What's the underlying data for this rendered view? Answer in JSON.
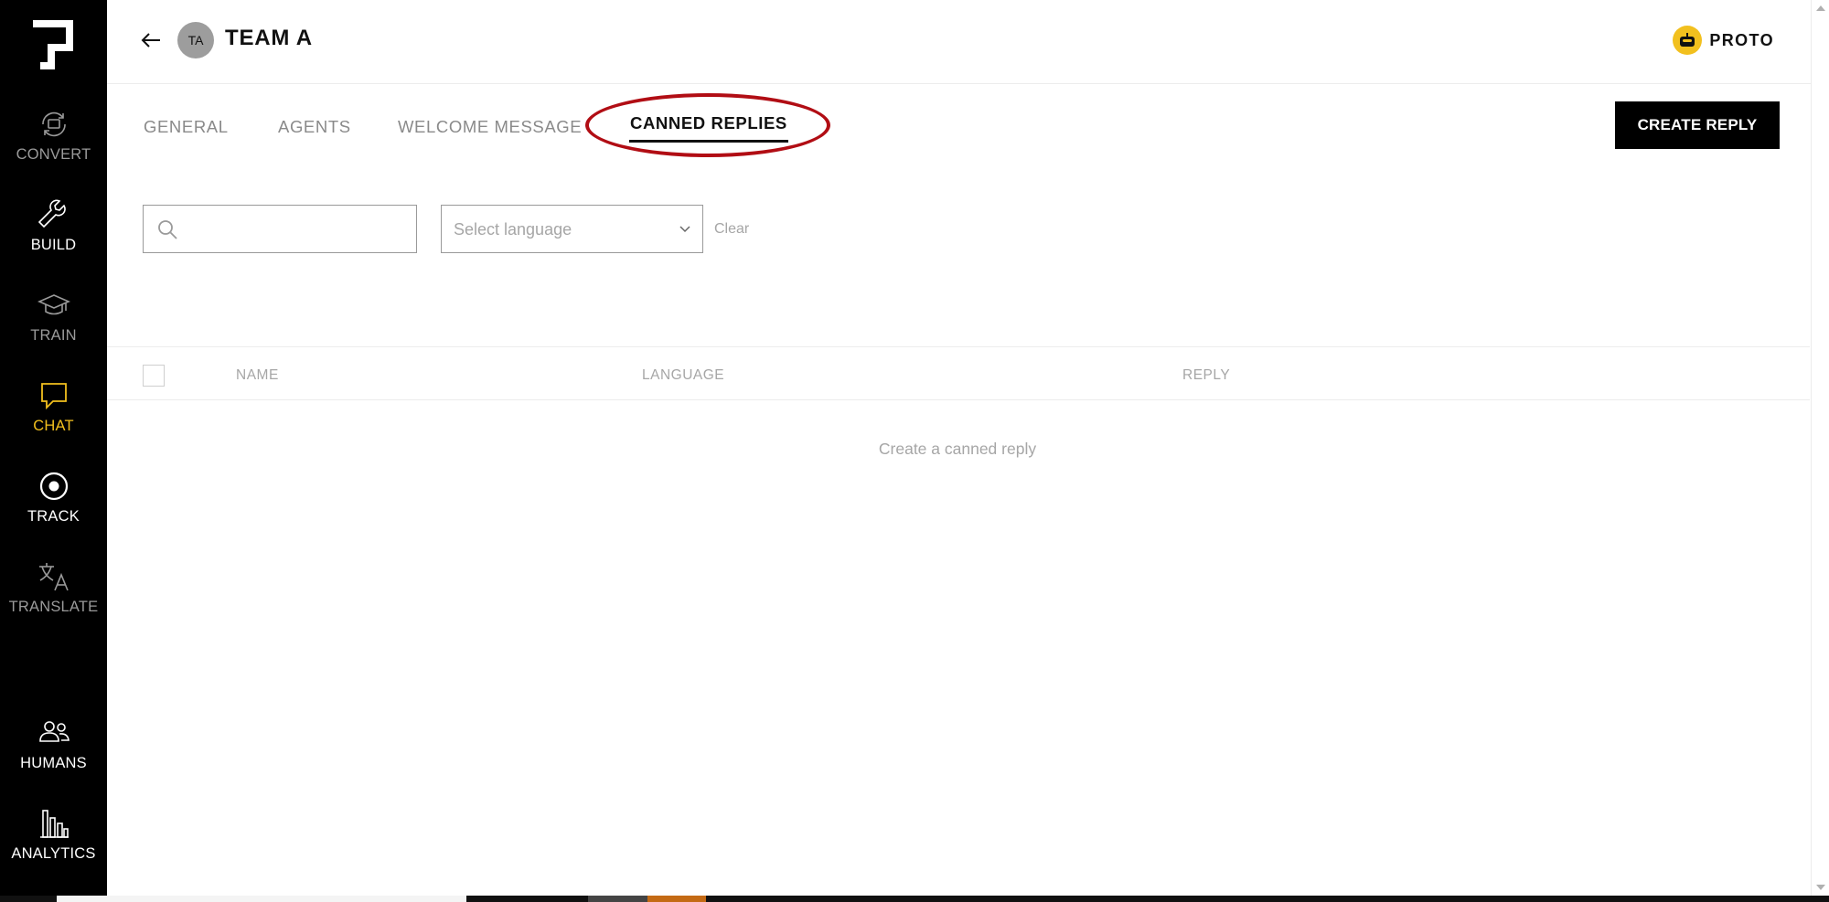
{
  "sidebar": {
    "logo_icon": "brand-logo",
    "items": [
      {
        "label": "CONVERT",
        "icon": "convert-icon",
        "state": "dim"
      },
      {
        "label": "BUILD",
        "icon": "wrench-icon",
        "state": "normal"
      },
      {
        "label": "TRAIN",
        "icon": "graduation-cap-icon",
        "state": "dim"
      },
      {
        "label": "CHAT",
        "icon": "chat-bubble-icon",
        "state": "active"
      },
      {
        "label": "TRACK",
        "icon": "target-icon",
        "state": "normal"
      },
      {
        "label": "TRANSLATE",
        "icon": "translate-icon",
        "state": "dim"
      },
      {
        "label": "HUMANS",
        "icon": "people-icon",
        "state": "normal"
      },
      {
        "label": "ANALYTICS",
        "icon": "bar-chart-icon",
        "state": "normal"
      }
    ]
  },
  "header": {
    "back_icon": "arrow-left-icon",
    "team_initials": "TA",
    "team_name": "TEAM A",
    "account_icon": "robot-icon",
    "account_name": "PROTO"
  },
  "tabs": [
    {
      "label": "GENERAL",
      "active": false
    },
    {
      "label": "AGENTS",
      "active": false
    },
    {
      "label": "WELCOME MESSAGE",
      "active": false
    },
    {
      "label": "CANNED REPLIES",
      "active": true
    }
  ],
  "actions": {
    "create_reply": "CREATE REPLY"
  },
  "filters": {
    "search_value": "",
    "search_placeholder": "",
    "language_placeholder": "Select language",
    "clear_label": "Clear"
  },
  "table": {
    "columns": [
      "NAME",
      "LANGUAGE",
      "REPLY"
    ],
    "rows": [],
    "empty_message": "Create a canned reply"
  },
  "colors": {
    "sidebar_bg": "#000000",
    "active_accent": "#f2c01e",
    "highlight_ring": "#b10d14",
    "primary_button": "#000000"
  }
}
